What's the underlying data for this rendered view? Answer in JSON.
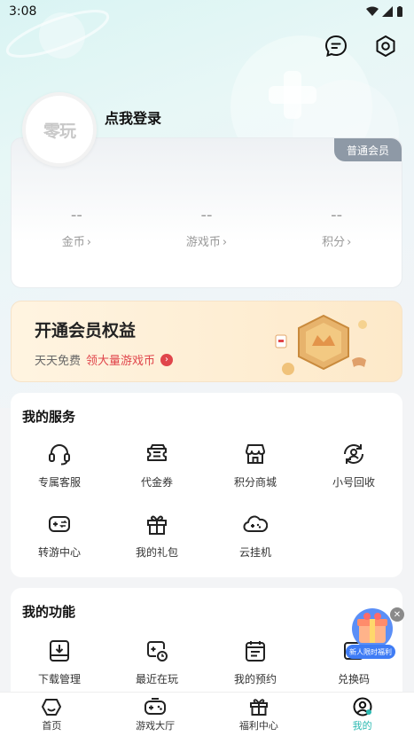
{
  "status": {
    "time": "3:08"
  },
  "profile": {
    "avatar_text": "零玩",
    "login_label": "点我登录"
  },
  "member_card": {
    "badge": "普通会员",
    "stats": [
      {
        "value": "--",
        "label": "金币"
      },
      {
        "value": "--",
        "label": "游戏币"
      },
      {
        "value": "--",
        "label": "积分"
      }
    ]
  },
  "vip_banner": {
    "title": "开通会员权益",
    "sub_prefix": "天天免费",
    "sub_highlight": "领大量游戏币"
  },
  "services": {
    "title": "我的服务",
    "items": [
      {
        "label": "专属客服",
        "icon": "headset-icon"
      },
      {
        "label": "代金券",
        "icon": "coupon-icon"
      },
      {
        "label": "积分商城",
        "icon": "store-icon"
      },
      {
        "label": "小号回收",
        "icon": "recycle-icon"
      },
      {
        "label": "转游中心",
        "icon": "gamepad-icon"
      },
      {
        "label": "我的礼包",
        "icon": "gift-icon"
      },
      {
        "label": "云挂机",
        "icon": "cloud-gamepad-icon"
      }
    ]
  },
  "functions": {
    "title": "我的功能",
    "items": [
      {
        "label": "下载管理",
        "icon": "download-icon"
      },
      {
        "label": "最近在玩",
        "icon": "recent-game-icon"
      },
      {
        "label": "我的预约",
        "icon": "calendar-icon"
      },
      {
        "label": "兑换码",
        "icon": "code-icon"
      }
    ]
  },
  "promo": {
    "label": "新人限时福利"
  },
  "tabbar": {
    "tabs": [
      {
        "label": "首页",
        "icon": "home-icon"
      },
      {
        "label": "游戏大厅",
        "icon": "gamepad-icon"
      },
      {
        "label": "福利中心",
        "icon": "gift-icon"
      },
      {
        "label": "我的",
        "icon": "profile-icon"
      }
    ],
    "active_color": "#2bb9b1"
  }
}
